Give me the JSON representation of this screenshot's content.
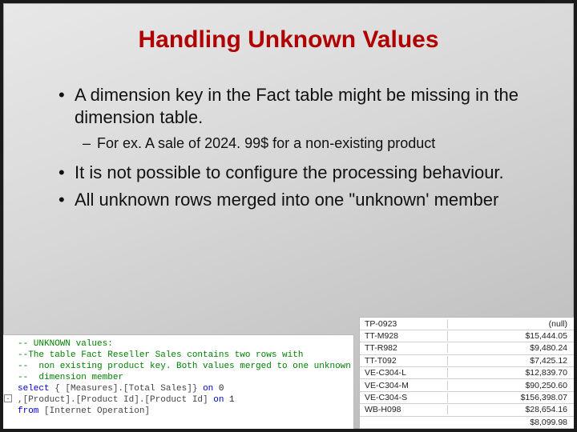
{
  "title": "Handling Unknown Values",
  "bullets": {
    "b0": "A dimension key in the Fact table might be missing in the dimension table.",
    "b0a": "For ex. A sale of 2024. 99$ for a non-existing product",
    "b1": "It is not possible to configure the processing behaviour.",
    "b2": "All unknown rows merged into one \"unknown' member"
  },
  "code": {
    "l1": "-- UNKNOWN values:",
    "l2": "--The table Fact Reseller Sales contains two rows with",
    "l3": "--  non existing product key. Both values merged to one unknown",
    "l4": "--  dimension member",
    "l5_kw": "select ",
    "l5_rest": "{ [Measures].[Total Sales]} ",
    "l5_kw2": "on",
    "l5_end": " 0",
    "l6_pre": ",[Product].[Product Id].[Product Id] ",
    "l6_kw": "on",
    "l6_end": " 1",
    "l7_kw": "from ",
    "l7_rest": "[Internet Operation]"
  },
  "table": [
    {
      "id": "TP-0923",
      "val": "(null)"
    },
    {
      "id": "TT-M928",
      "val": "$15,444.05"
    },
    {
      "id": "TT-R982",
      "val": "$9,480.24"
    },
    {
      "id": "TT-T092",
      "val": "$7,425.12"
    },
    {
      "id": "VE-C304-L",
      "val": "$12,839.70"
    },
    {
      "id": "VE-C304-M",
      "val": "$90,250.60"
    },
    {
      "id": "VE-C304-S",
      "val": "$156,398.07"
    },
    {
      "id": "WB-H098",
      "val": "$28,654.16"
    },
    {
      "id": "",
      "val": "$8,099.98"
    }
  ]
}
